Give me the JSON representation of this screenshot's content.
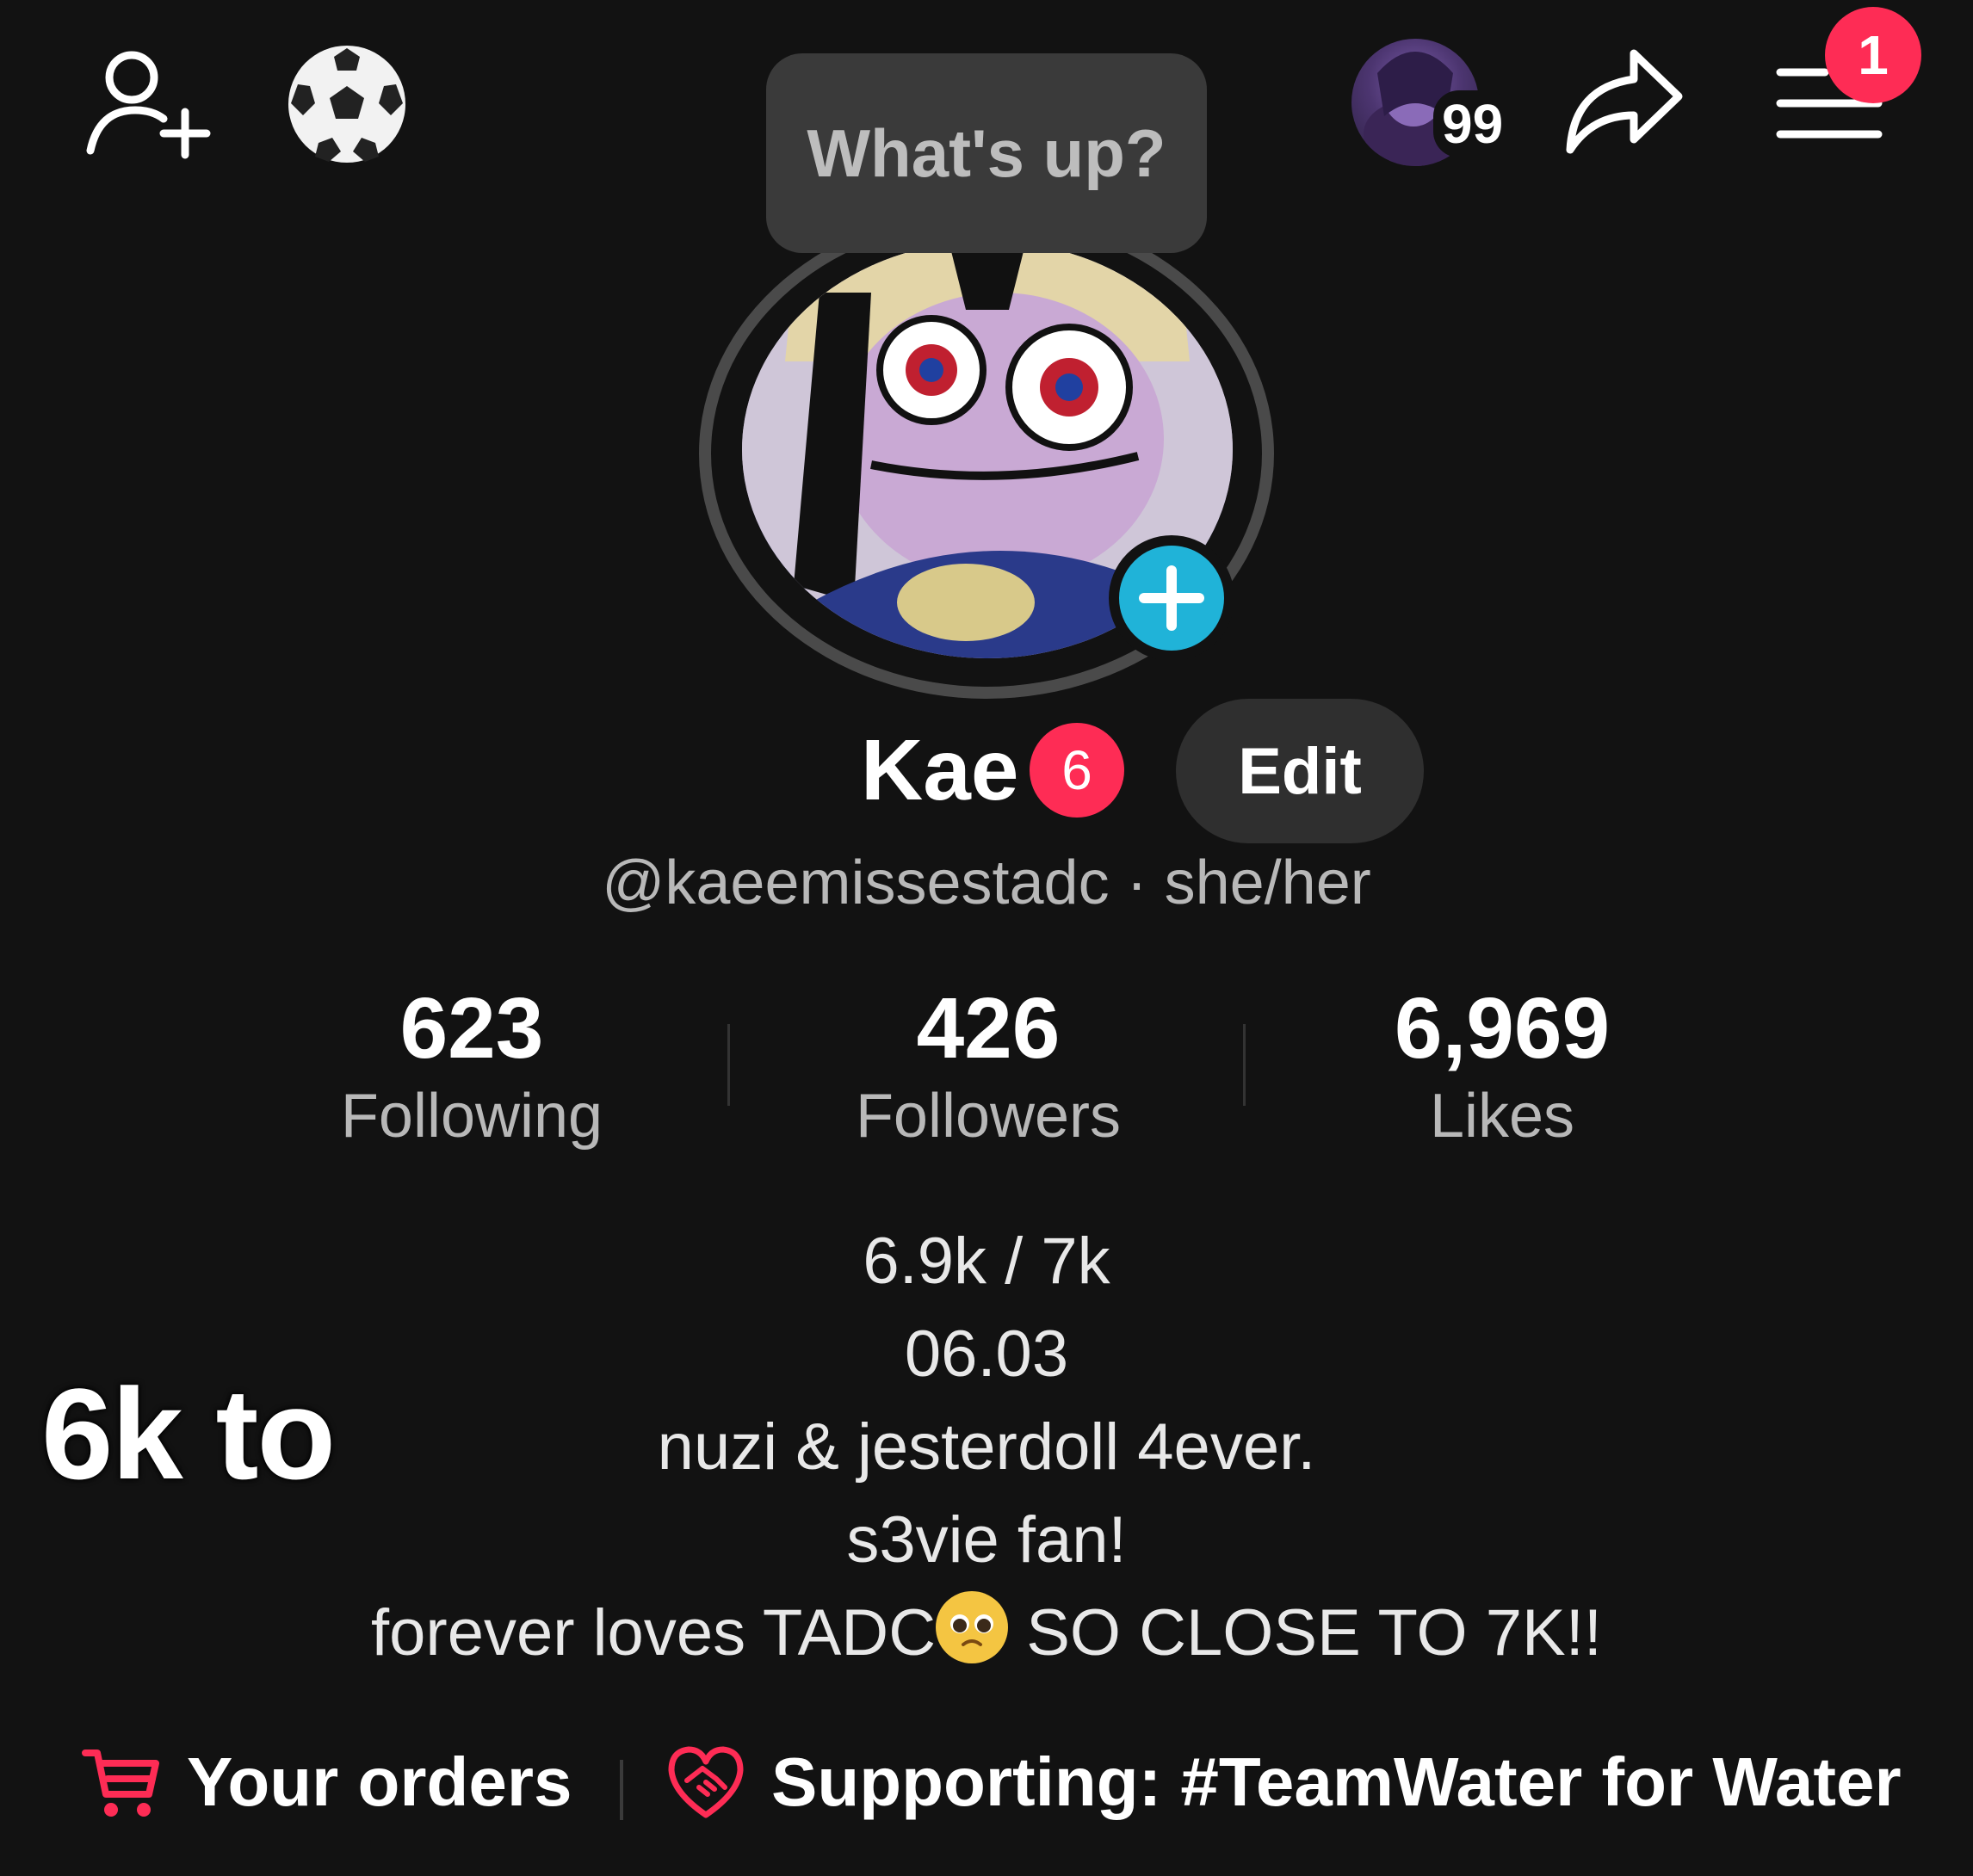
{
  "top_bar": {
    "story_count": "99",
    "menu_badge": "1"
  },
  "note": {
    "text": "What's up?"
  },
  "profile": {
    "name": "Kae",
    "name_badge": "6",
    "edit_label": "Edit",
    "handle_line": "@kaeemissestadc · she/her"
  },
  "stats": [
    {
      "value": "623",
      "label": "Following"
    },
    {
      "value": "426",
      "label": "Followers"
    },
    {
      "value": "6,969",
      "label": "Likes"
    }
  ],
  "bio": {
    "line1": "6.9k / 7k",
    "line2": "06.03",
    "line3": "nuzi & jesterdoll 4ever.",
    "line4": "s3vie fan!",
    "line5_a": "forever loves TADC",
    "line5_b": " SO CLOSE TO 7K!!"
  },
  "overlay_text": "6k to",
  "bottom": {
    "orders_label": "Your orders",
    "supporting_label": "Supporting: #TeamWater for Water"
  },
  "colors": {
    "background": "#121212",
    "accent_red": "#fe2c55",
    "accent_blue": "#20b3d8"
  },
  "icons": {
    "add_friend": "add-friend-icon",
    "soccer": "soccer-ball-icon",
    "share": "share-icon",
    "menu": "menu-icon",
    "plus": "plus-icon",
    "cart": "cart-icon",
    "heart_hands": "heart-handshake-icon"
  }
}
